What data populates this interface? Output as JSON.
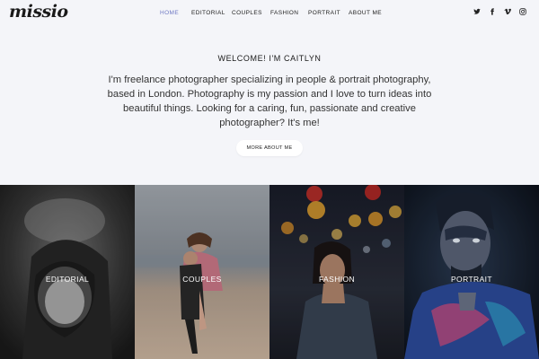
{
  "header": {
    "logo": "missio",
    "nav": [
      {
        "label": "HOME",
        "active": true
      },
      {
        "label": "EDITORIAL"
      },
      {
        "label": "COUPLES"
      },
      {
        "label": "FASHION"
      },
      {
        "label": "PORTRAIT"
      },
      {
        "label": "ABOUT ME"
      }
    ],
    "social_icons": [
      "twitter-icon",
      "facebook-icon",
      "vimeo-icon",
      "instagram-icon"
    ]
  },
  "intro": {
    "title": "WELCOME! I'M CAITLYN",
    "text": "I'm freelance photographer specializing in people & portrait photography, based in London. Photography is my passion and I love to turn ideas into beautiful things. Looking for a caring, fun, passionate and creative photographer? It's me!",
    "button": "MORE ABOUT ME"
  },
  "gallery": [
    {
      "label": "EDITORIAL"
    },
    {
      "label": "COUPLES"
    },
    {
      "label": "FASHION"
    },
    {
      "label": "PORTRAIT"
    }
  ],
  "colors": {
    "accent": "#6f79c4",
    "background": "#f4f5f9"
  }
}
